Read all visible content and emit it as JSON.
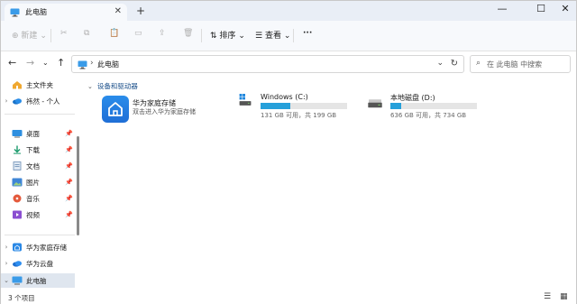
{
  "window": {
    "tab_title": "此电脑",
    "tab_close": "✕",
    "new_tab": "+",
    "minimize": "—",
    "maximize": "☐",
    "close": "✕"
  },
  "toolbar": {
    "new_label": "新建",
    "sort_label": "排序",
    "view_label": "查看",
    "more": "···"
  },
  "address": {
    "path": "此电脑",
    "search_placeholder": "在 此电脑 中搜索"
  },
  "sidebar": {
    "items": [
      {
        "label": "主文件夹",
        "icon": "home-icon",
        "chevron": "",
        "pinned": false
      },
      {
        "label": "祎然 - 个人",
        "icon": "onedrive-icon",
        "chevron": "›",
        "pinned": false
      },
      {
        "label": "桌面",
        "icon": "desktop-icon",
        "chevron": "",
        "pinned": true
      },
      {
        "label": "下载",
        "icon": "download-icon",
        "chevron": "",
        "pinned": true
      },
      {
        "label": "文档",
        "icon": "documents-icon",
        "chevron": "",
        "pinned": true
      },
      {
        "label": "图片",
        "icon": "pictures-icon",
        "chevron": "",
        "pinned": true
      },
      {
        "label": "音乐",
        "icon": "music-icon",
        "chevron": "",
        "pinned": true
      },
      {
        "label": "视频",
        "icon": "videos-icon",
        "chevron": "",
        "pinned": true
      },
      {
        "label": "华为家庭存储",
        "icon": "huawei-storage-icon",
        "chevron": "›",
        "pinned": false
      },
      {
        "label": "华为云盘",
        "icon": "huawei-cloud-icon",
        "chevron": "›",
        "pinned": false
      },
      {
        "label": "此电脑",
        "icon": "pc-icon",
        "chevron": "⌄",
        "pinned": false
      }
    ]
  },
  "content": {
    "group_header": "设备和驱动器",
    "huawei": {
      "title": "华为家庭存储",
      "subtitle": "双击进入华为家庭存储"
    },
    "drives": [
      {
        "name": "Windows (C:)",
        "info": "131 GB 可用，共 199 GB",
        "used_fraction": 0.34
      },
      {
        "name": "本地磁盘 (D:)",
        "info": "636 GB 可用，共 734 GB",
        "used_fraction": 0.13
      }
    ]
  },
  "status": {
    "count": "3 个项目"
  },
  "colors": {
    "accent": "#26a0da",
    "header_blue": "#1a4f8a",
    "selected_bg": "#dfe6ef"
  }
}
